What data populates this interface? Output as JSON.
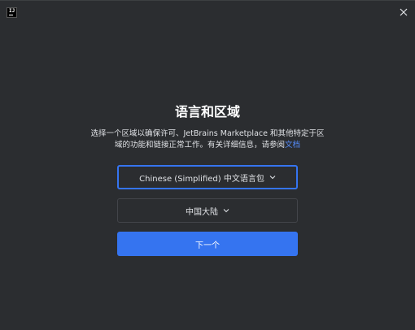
{
  "app": {
    "logo_text": "IJ",
    "close_icon": "close-icon",
    "logo_icon": "intellij-logo-icon"
  },
  "dialog": {
    "title": "语言和区域",
    "description_text": "选择一个区域以确保许可、JetBrains Marketplace 和其他特定于区域的功能和链接正常工作。有关详细信息，请参阅",
    "description_link": "文档",
    "language_select": {
      "value": "Chinese (Simplified) 中文语言包",
      "icon": "chevron-down-icon"
    },
    "region_select": {
      "value": "中国大陆",
      "icon": "chevron-down-icon"
    },
    "next_button": "下一个"
  },
  "colors": {
    "background": "#2b2d30",
    "accent": "#3574f0",
    "link": "#548af7",
    "text": "#dfe1e5",
    "border": "#43454a"
  }
}
